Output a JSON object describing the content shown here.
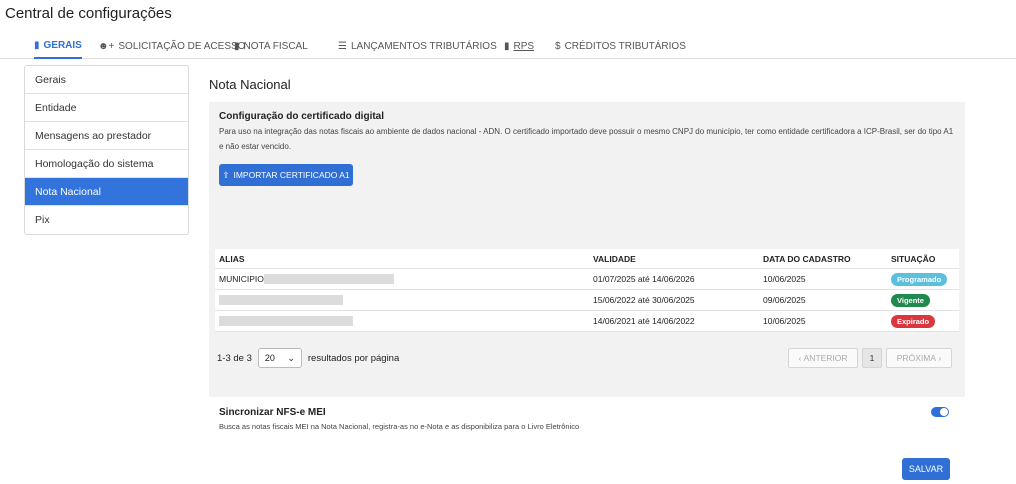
{
  "page": {
    "title": "Central de configurações"
  },
  "tabs": [
    {
      "label": "GERAIS",
      "icon": "bookmark-icon",
      "active": true
    },
    {
      "label": "SOLICITAÇÃO DE ACESSO",
      "icon": "user-plus-icon"
    },
    {
      "label": "NOTA FISCAL",
      "icon": "file-icon"
    },
    {
      "label": "LANÇAMENTOS TRIBUTÁRIOS",
      "icon": "columns-icon"
    },
    {
      "label": "RPS",
      "icon": "file-icon"
    },
    {
      "label": "CRÉDITOS TRIBUTÁRIOS",
      "icon": "dollar-icon"
    }
  ],
  "sidebar": {
    "items": [
      {
        "label": "Gerais"
      },
      {
        "label": "Entidade"
      },
      {
        "label": "Mensagens ao prestador"
      },
      {
        "label": "Homologação do sistema"
      },
      {
        "label": "Nota Nacional",
        "active": true
      },
      {
        "label": "Pix"
      }
    ]
  },
  "main": {
    "title": "Nota Nacional",
    "certificate": {
      "title": "Configuração do certificado digital",
      "description": "Para uso na integração das notas fiscais ao ambiente de dados nacional - ADN. O certificado importado deve possuir o mesmo CNPJ do município, ter como entidade certificadora a ICP-Brasil, ser do tipo A1 e não estar vencido.",
      "import_label": "IMPORTAR CERTIFICADO A1"
    },
    "table": {
      "headers": {
        "alias": "ALIAS",
        "validade": "VALIDADE",
        "data_cadastro": "DATA DO CADASTRO",
        "situacao": "SITUAÇÃO"
      },
      "rows": [
        {
          "alias": "MUNICIPIO",
          "validade": "01/07/2025 até 14/06/2026",
          "data_cadastro": "10/06/2025",
          "situacao": "Programado",
          "status_color": "#5bc0de"
        },
        {
          "alias": "",
          "validade": "15/06/2022 até 30/06/2025",
          "data_cadastro": "09/06/2025",
          "situacao": "Vigente",
          "status_color": "#1e8a4c"
        },
        {
          "alias": "",
          "validade": "14/06/2021 até 14/06/2022",
          "data_cadastro": "10/06/2025",
          "situacao": "Expirado",
          "status_color": "#d9363e"
        }
      ]
    },
    "pagination": {
      "range": "1-3 de 3",
      "page_size": "20",
      "per_page_label": "resultados por página",
      "prev_label": "ANTERIOR",
      "current_page": "1",
      "next_label": "PRÓXIMA"
    },
    "sync": {
      "title": "Sincronizar NFS-e MEI",
      "description": "Busca as notas fiscais MEI na Nota Nacional, registra-as no e-Nota e as disponibiliza para o Livro Eletrônico",
      "enabled": true
    },
    "save_label": "SALVAR"
  },
  "colors": {
    "accent": "#2f6fd6",
    "sidebar_active": "#3273dc"
  }
}
